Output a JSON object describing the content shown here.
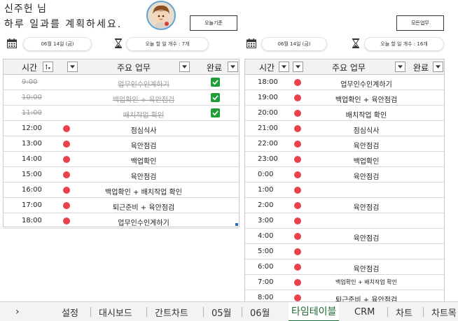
{
  "greeting": {
    "name": "신주헌 님",
    "subtitle": "하루 일과를 계획하세요."
  },
  "buttons": {
    "left": "오늘기준",
    "right": "모든업무"
  },
  "left_panel": {
    "date": "06월 14일 (금)",
    "task_count": "오늘 할 일 개수 : 7개",
    "headers": {
      "time": "시간",
      "task": "주요 업무",
      "done": "완료"
    },
    "rows": [
      {
        "time": "9:00",
        "task": "업무인수인계하기",
        "done": true
      },
      {
        "time": "10:00",
        "task": "백업확인 + 육안점검",
        "done": true
      },
      {
        "time": "11:00",
        "task": "배치작업 확인",
        "done": true
      },
      {
        "time": "12:00",
        "task": "점심식사",
        "done": false
      },
      {
        "time": "13:00",
        "task": "육안점검",
        "done": false
      },
      {
        "time": "14:00",
        "task": "백업확인",
        "done": false
      },
      {
        "time": "15:00",
        "task": "육안점검",
        "done": false
      },
      {
        "time": "16:00",
        "task": "백업확인 + 배치작업 확인",
        "done": false
      },
      {
        "time": "17:00",
        "task": "퇴근준비 + 육안점검",
        "done": false
      },
      {
        "time": "18:00",
        "task": "업무인수인계하기",
        "done": false
      }
    ]
  },
  "right_panel": {
    "date": "06월 14일 (금)",
    "task_count": "오늘 할 일 개수 : 16개",
    "headers": {
      "time": "시간",
      "task": "주요 업무",
      "done": "완료"
    },
    "rows": [
      {
        "time": "18:00",
        "task": "업무인수인계하기"
      },
      {
        "time": "19:00",
        "task": "백업확인 + 육안점검"
      },
      {
        "time": "20:00",
        "task": "배치작업 확인"
      },
      {
        "time": "21:00",
        "task": "점심식사"
      },
      {
        "time": "22:00",
        "task": "육안점검"
      },
      {
        "time": "23:00",
        "task": "백업확인"
      },
      {
        "time": "0:00",
        "task": "육안점검"
      },
      {
        "time": "1:00",
        "task": ""
      },
      {
        "time": "2:00",
        "task": "육안점검"
      },
      {
        "time": "3:00",
        "task": ""
      },
      {
        "time": "4:00",
        "task": "육안점검"
      },
      {
        "time": "5:00",
        "task": ""
      },
      {
        "time": "6:00",
        "task": "육안점검"
      },
      {
        "time": "7:00",
        "task": "백업확인 + 배치작업 확인"
      },
      {
        "time": "8:00",
        "task": "퇴근준비 + 육안점검"
      }
    ]
  },
  "sheet_tabs": {
    "nav": "›",
    "items": [
      "설정",
      "대시보드",
      "간트차트",
      "05월",
      "06월",
      "타임테이블",
      "CRM",
      "차트",
      "차트목"
    ],
    "active_index": 5
  },
  "colors": {
    "dot": "#e8414a",
    "check": "#1e9e3a",
    "active_tab": "#1d6b35"
  }
}
